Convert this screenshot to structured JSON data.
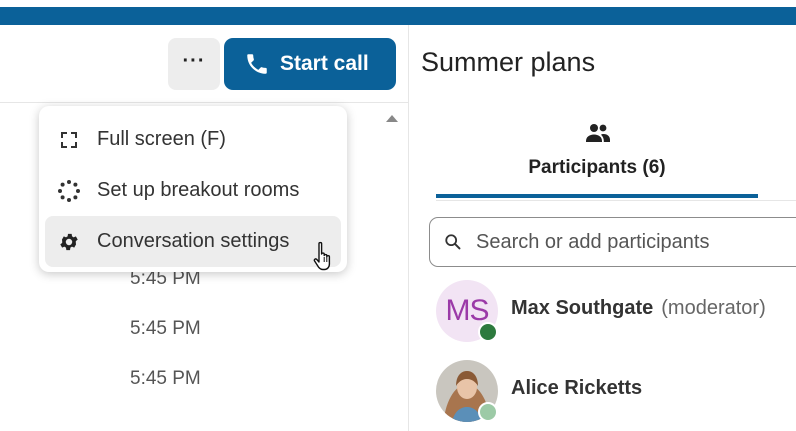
{
  "header": {
    "more_label": "···",
    "start_call_label": "Start call"
  },
  "timeline": {
    "times": [
      "5:45 PM",
      "5:45 PM",
      "5:45 PM"
    ]
  },
  "menu": {
    "items": [
      {
        "label": "Full screen (F)",
        "icon": "fullscreen-icon"
      },
      {
        "label": "Set up breakout rooms",
        "icon": "breakout-rooms-icon"
      },
      {
        "label": "Conversation settings",
        "icon": "gear-icon",
        "hovered": true
      }
    ]
  },
  "conversation": {
    "title": "Summer plans"
  },
  "tabs": [
    {
      "label": "Participants (6)",
      "icon": "participants-icon",
      "active": true
    }
  ],
  "search": {
    "placeholder": "Search or add participants",
    "value": ""
  },
  "participants": [
    {
      "name": "Max Southgate",
      "role": "(moderator)",
      "initials": "MS",
      "status": "online",
      "status_color": "#2d7a3e"
    },
    {
      "name": "Alice Ricketts",
      "role": "",
      "initials": "",
      "status": "offline",
      "status_color": "#9ccaa6"
    }
  ],
  "colors": {
    "accent": "#0b6199",
    "avatar_bg": "#f2e4f4",
    "avatar_text": "#9b3aa8"
  }
}
